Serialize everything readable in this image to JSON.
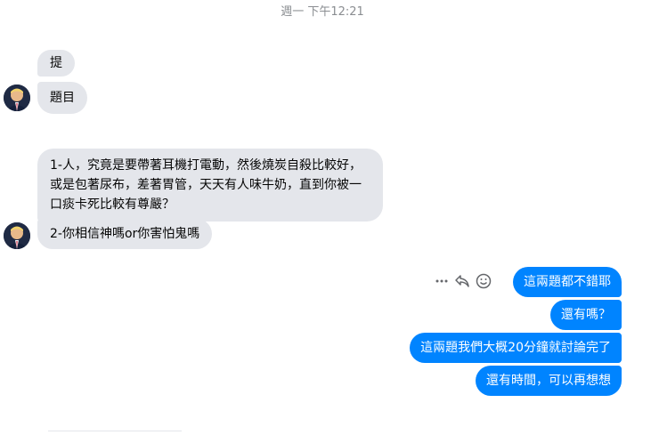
{
  "timestamp": "週一 下午12:21",
  "incoming": [
    {
      "text": "提"
    },
    {
      "text": "題目"
    },
    {
      "text": "1-人，究竟是要帶著耳機打電動，然後燒炭自殺比較好，或是包著尿布，差著胃管，天天有人味牛奶，直到你被一口痰卡死比較有尊嚴？"
    },
    {
      "text": "2-你相信神嗎or你害怕鬼嗎"
    }
  ],
  "outgoing": [
    {
      "text": "這兩題都不錯耶"
    },
    {
      "text": "還有嗎？"
    },
    {
      "text": "這兩題我們大概20分鐘就討論完了"
    },
    {
      "text": "還有時間，可以再想想"
    }
  ],
  "message_actions": {
    "icons": [
      "more-options-icon",
      "reply-icon",
      "react-emoji-icon"
    ]
  },
  "colors": {
    "incoming_bubble": "#e4e6eb",
    "outgoing_bubble": "#0084ff",
    "timestamp_text": "#8a8d91"
  }
}
